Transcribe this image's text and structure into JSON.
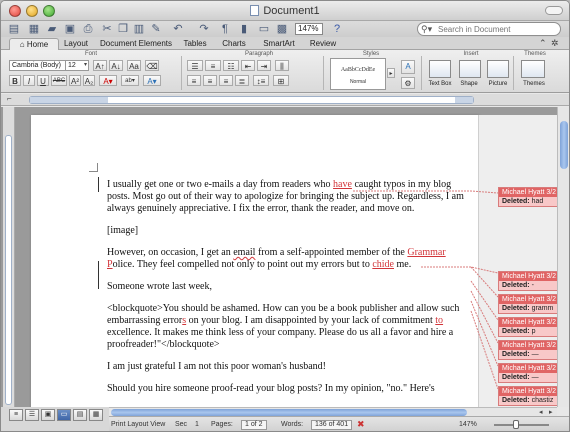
{
  "window": {
    "title": "Document1"
  },
  "toolbar": {
    "zoom": "147%",
    "search_placeholder": "Search in Document"
  },
  "tabs": [
    "Home",
    "Layout",
    "Document Elements",
    "Tables",
    "Charts",
    "SmartArt",
    "Review"
  ],
  "ribbon": {
    "groups": {
      "font": "Font",
      "paragraph": "Paragraph",
      "styles": "Styles",
      "insert": "Insert",
      "themes": "Themes"
    },
    "font_name": "Cambria (Body)",
    "font_size": "12",
    "style_sample": "AaBbCcDdEe",
    "style_name": "Normal",
    "insert": {
      "text_box": "Text Box",
      "shape": "Shape",
      "picture": "Picture"
    },
    "themes_label": "Themes"
  },
  "document": {
    "p1": {
      "a": "I usually get one or two e-mails a day from readers who ",
      "ins": "have",
      "b": " caught typos in my blog posts. Most go out of their way to apologize for bringing the subject up. Regardless, I am always genuinely appreciative. I fix the error, thank the reader, and move on."
    },
    "p2": "[image]",
    "p3": {
      "a": "However, on occasion, I get an ",
      "email": "email",
      "b": " from a self-appointed member of the ",
      "grammar": "Grammar",
      "c": " ",
      "police": "P",
      "d": "olice. They feel compelled",
      "e": " not only to point out my errors",
      "f": " but to ",
      "chide": "chide",
      "g": " me."
    },
    "p4": "Someone wrote last week,",
    "p5": {
      "a": "<blockquote>You should be ashamed. How can you be a book publisher and allow such embarrassing error",
      "s": "s",
      "b": " on your blog. I am disappointed by your lack of commitment ",
      "to": "to",
      "c": " excellence. It makes me think less of your company. Please",
      "d": " do us all a favor and hire a proofreader!\"</blockquote>"
    },
    "p6": "I am just grateful I am not this poor woman's husband!",
    "p7": "Should you hire someone proof-read your blog posts? In my opinion, \"no.\" Here's"
  },
  "comments": [
    {
      "author": "Michael Hyatt 3/2",
      "label": "Deleted:",
      "text": "had"
    },
    {
      "author": "Michael Hyatt 3/2",
      "label": "Deleted:",
      "text": "-"
    },
    {
      "author": "Michael Hyatt 3/2",
      "label": "Deleted:",
      "text": "gramm"
    },
    {
      "author": "Michael Hyatt 3/2",
      "label": "Deleted:",
      "text": "p"
    },
    {
      "author": "Michael Hyatt 3/2",
      "label": "Deleted:",
      "text": "—"
    },
    {
      "author": "Michael Hyatt 3/2",
      "label": "Deleted:",
      "text": "—"
    },
    {
      "author": "Michael Hyatt 3/2",
      "label": "Deleted:",
      "text": "chastiz"
    }
  ],
  "status": {
    "view": "Print Layout View",
    "sec_label": "Sec",
    "sec": "1",
    "pages_label": "Pages:",
    "pages": "1 of 2",
    "words_label": "Words:",
    "words": "136 of 401",
    "zoom": "147%"
  },
  "colors": {
    "tracked_change": "#d2353a",
    "balloon_header": "#e06464",
    "balloon_body": "#f8c8c8",
    "scroll_thumb": "#7fa3d8"
  }
}
